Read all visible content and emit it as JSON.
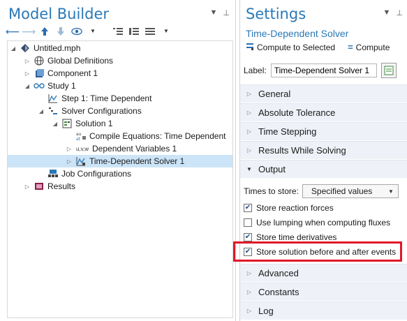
{
  "model_builder": {
    "title": "Model Builder",
    "tree": [
      {
        "label": "Untitled.mph",
        "icon": "model-icon"
      },
      {
        "label": "Global Definitions",
        "icon": "globe-icon"
      },
      {
        "label": "Component 1",
        "icon": "component-icon"
      },
      {
        "label": "Study 1",
        "icon": "study-icon"
      },
      {
        "label": "Step 1: Time Dependent",
        "icon": "time-dependent-step-icon"
      },
      {
        "label": "Solver Configurations",
        "icon": "solver-configurations-icon"
      },
      {
        "label": "Solution 1",
        "icon": "solution-icon"
      },
      {
        "label": "Compile Equations: Time Dependent",
        "icon": "compile-equations-icon"
      },
      {
        "label": "Dependent Variables 1",
        "icon": "dependent-variables-icon",
        "icon_text": "u,v,w"
      },
      {
        "label": "Time-Dependent Solver 1",
        "icon": "time-dependent-solver-icon",
        "selected": true
      },
      {
        "label": "Job Configurations",
        "icon": "job-configurations-icon"
      },
      {
        "label": "Results",
        "icon": "results-icon"
      }
    ]
  },
  "settings": {
    "title": "Settings",
    "subtitle": "Time-Dependent Solver",
    "compute_to_selected": "Compute to Selected",
    "compute": "Compute",
    "label_caption": "Label:",
    "label_value": "Time-Dependent Solver 1",
    "sections": {
      "general": "General",
      "absolute_tolerance": "Absolute Tolerance",
      "time_stepping": "Time Stepping",
      "results_while_solving": "Results While Solving",
      "output": "Output",
      "advanced": "Advanced",
      "constants": "Constants",
      "log": "Log"
    },
    "output": {
      "times_to_store_label": "Times to store:",
      "times_to_store_value": "Specified values",
      "checks": [
        {
          "label": "Store reaction forces",
          "checked": true
        },
        {
          "label": "Use lumping when computing fluxes",
          "checked": false
        },
        {
          "label": "Store time derivatives",
          "checked": true
        },
        {
          "label": "Store solution before and after events",
          "checked": true
        }
      ]
    }
  },
  "colors": {
    "accent": "#2a79b7",
    "selected_row": "#cce4f7",
    "section_bg": "#eef2f8",
    "highlight": "#e0182a"
  }
}
